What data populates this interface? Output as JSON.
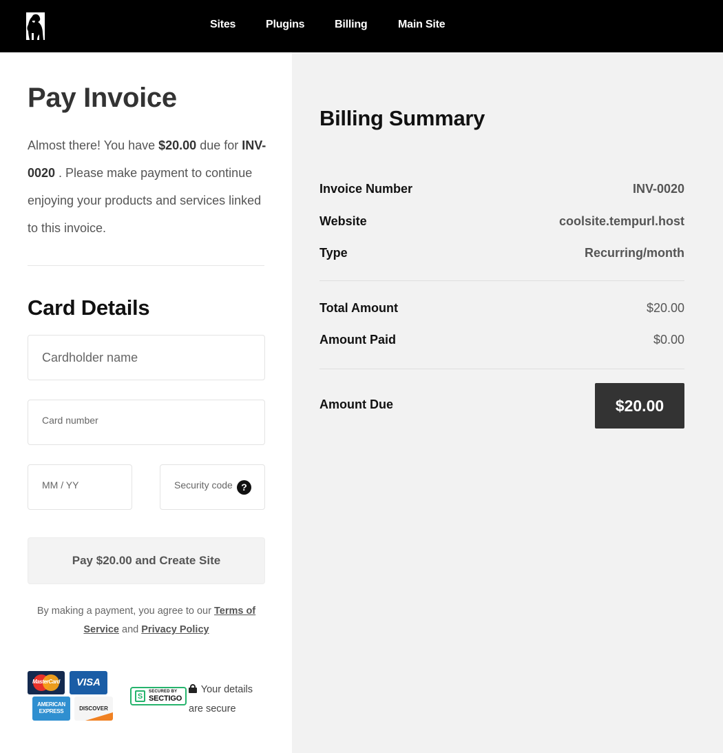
{
  "header": {
    "logo_alt": "gorilla-logo",
    "nav": [
      {
        "label": "Sites"
      },
      {
        "label": "Plugins"
      },
      {
        "label": "Billing"
      },
      {
        "label": "Main Site"
      }
    ]
  },
  "payment": {
    "title": "Pay Invoice",
    "intro_prefix": "Almost there! You have ",
    "intro_amount": "$20.00",
    "intro_mid": " due for ",
    "intro_invoice": "INV-0020",
    "intro_suffix": " . Please make payment to continue enjoying your products and services linked to this invoice.",
    "card_details_title": "Card Details",
    "fields": {
      "cardholder_placeholder": "Cardholder name",
      "card_number_placeholder": "Card number",
      "expiry_placeholder": "MM / YY",
      "security_code_placeholder": "Security code",
      "help_glyph": "?"
    },
    "pay_button_label": "Pay $20.00 and Create Site",
    "legal_prefix": "By making a payment, you agree to our ",
    "terms_link": "Terms of Service",
    "legal_mid": " and ",
    "privacy_link": "Privacy Policy",
    "legal_suffix": "",
    "card_logos": {
      "mastercard": "MasterCard",
      "visa": "VISA",
      "amex_line1": "AMERICAN",
      "amex_line2": "EXPRESS",
      "discover": "DISCOVER"
    },
    "sectigo": {
      "glyph": "S",
      "line1": "SECURED BY",
      "line2": "SECTIGO"
    },
    "secure_text": "Your details are secure"
  },
  "summary": {
    "title": "Billing Summary",
    "rows": [
      {
        "label": "Invoice Number",
        "value": "INV-0020"
      },
      {
        "label": "Website",
        "value": "coolsite.tempurl.host"
      },
      {
        "label": "Type",
        "value": "Recurring/month"
      }
    ],
    "amounts": [
      {
        "label": "Total Amount",
        "value": "$20.00"
      },
      {
        "label": "Amount Paid",
        "value": "$0.00"
      }
    ],
    "due_label": "Amount Due",
    "due_value": "$20.00"
  },
  "colors": {
    "topbar": "#000000",
    "summary_bg": "#f2f2f2",
    "due_box": "#333333",
    "sectigo_green": "#25b36c"
  }
}
